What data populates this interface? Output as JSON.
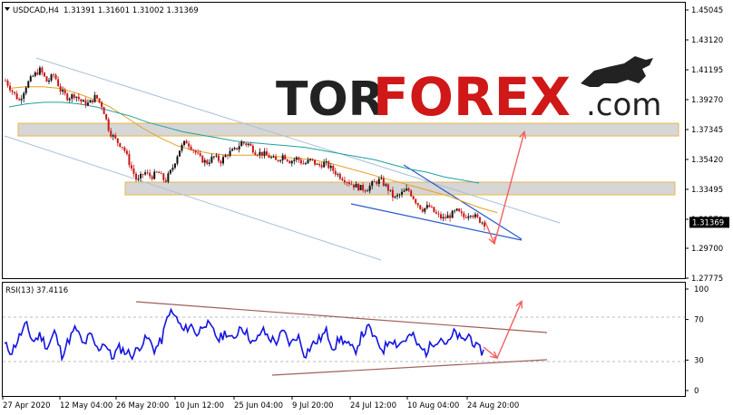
{
  "header": {
    "symbol": "USDCAD,H4",
    "ohlc": "1.31391 1.31601 1.31002 1.31369",
    "rsi_label": "RSI(13) 37.4116"
  },
  "watermark": {
    "tor": "TOR",
    "forex": "FOREX",
    "dotcom": ".com"
  },
  "chart_data": [
    {
      "type": "candlestick",
      "title": "USDCAD,H4",
      "y_ticks": [
        "1.45045",
        "1.43120",
        "1.41195",
        "1.39270",
        "1.37345",
        "1.35420",
        "1.33495",
        "1.31570",
        "1.29700",
        "1.27775"
      ],
      "ylim": [
        1.27,
        1.455
      ],
      "current_price": "1.31369",
      "x_ticks": [
        "27 Apr 2020",
        "12 May 04:00",
        "26 May 20:00",
        "10 Jun 12:00",
        "25 Jun 04:00",
        "9 Jul 20:00",
        "24 Jul 12:00",
        "10 Aug 04:00",
        "24 Aug 20:00"
      ],
      "price_path": [
        1.405,
        1.398,
        1.392,
        1.402,
        1.408,
        1.412,
        1.404,
        1.409,
        1.398,
        1.394,
        1.396,
        1.391,
        1.39,
        1.395,
        1.388,
        1.372,
        1.366,
        1.362,
        1.35,
        1.34,
        1.346,
        1.343,
        1.346,
        1.34,
        1.348,
        1.36,
        1.366,
        1.361,
        1.355,
        1.352,
        1.356,
        1.353,
        1.358,
        1.36,
        1.365,
        1.364,
        1.359,
        1.358,
        1.356,
        1.353,
        1.357,
        1.353,
        1.355,
        1.351,
        1.354,
        1.35,
        1.352,
        1.348,
        1.344,
        1.341,
        1.338,
        1.336,
        1.335,
        1.339,
        1.341,
        1.336,
        1.329,
        1.332,
        1.335,
        1.328,
        1.322,
        1.324,
        1.319,
        1.316,
        1.318,
        1.321,
        1.317,
        1.32,
        1.316,
        1.313
      ],
      "moving_averages": [
        {
          "color": "#e6a020",
          "values": [
            1.4,
            1.401,
            1.401,
            1.4,
            1.397,
            1.393,
            1.388,
            1.381,
            1.374,
            1.368,
            1.363,
            1.36,
            1.358,
            1.357,
            1.357,
            1.357,
            1.356,
            1.355,
            1.354,
            1.352,
            1.349,
            1.346,
            1.343,
            1.34,
            1.337,
            1.334,
            1.331,
            1.327,
            1.323,
            1.32
          ]
        },
        {
          "color": "#20a0a0",
          "values": [
            1.388,
            1.39,
            1.391,
            1.391,
            1.39,
            1.388,
            1.385,
            1.382,
            1.378,
            1.375,
            1.372,
            1.37,
            1.368,
            1.366,
            1.365,
            1.364,
            1.363,
            1.362,
            1.36,
            1.358,
            1.356,
            1.354,
            1.351,
            1.348,
            1.346,
            1.343,
            1.341,
            1.339
          ]
        }
      ],
      "resistance_zones": [
        1.3734,
        1.3355
      ],
      "projection_arrow": {
        "from": 1.3,
        "to": 1.372
      }
    },
    {
      "type": "line",
      "title": "RSI(13) 37.4116",
      "y_ticks": [
        "100",
        "70",
        "30",
        "0"
      ],
      "ylim": [
        0,
        100
      ],
      "levels": [
        70,
        30
      ],
      "values": [
        45,
        38,
        52,
        65,
        48,
        55,
        42,
        58,
        35,
        50,
        62,
        44,
        55,
        40,
        48,
        32,
        42,
        38,
        35,
        45,
        52,
        40,
        50,
        78,
        72,
        58,
        65,
        55,
        68,
        60,
        50,
        58,
        48,
        65,
        55,
        45,
        60,
        52,
        48,
        58,
        45,
        55,
        35,
        45,
        50,
        58,
        42,
        52,
        45,
        38,
        55,
        62,
        48,
        40,
        52,
        45,
        50,
        55,
        42,
        38,
        48,
        52,
        45,
        58,
        48,
        55,
        42,
        38
      ],
      "projection_arrow": {
        "from": 32,
        "to": 88
      }
    }
  ]
}
